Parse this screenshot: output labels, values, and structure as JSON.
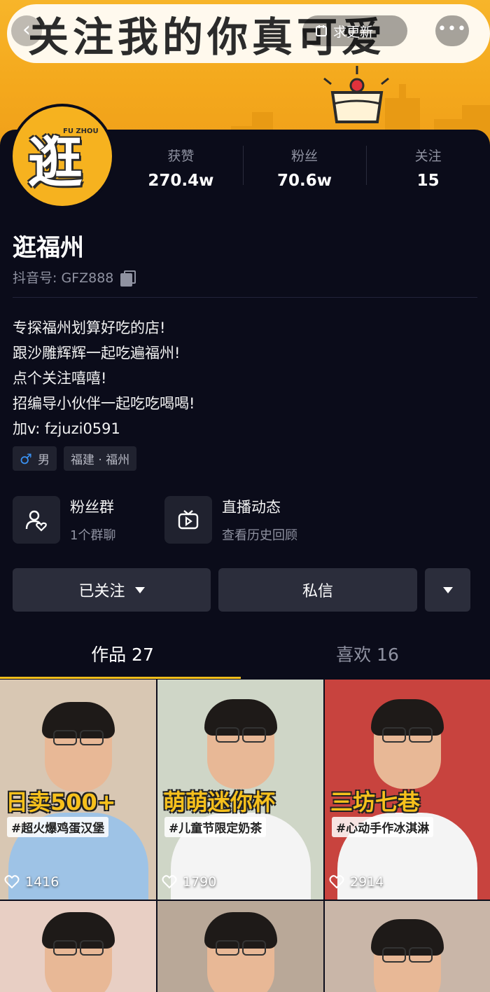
{
  "banner": {
    "title": "关注我的你真可爱",
    "update_label": "求更新",
    "back_glyph": "‹",
    "more_glyph": "•••"
  },
  "avatar": {
    "char": "逛",
    "sub": "FU ZHOU"
  },
  "stats": [
    {
      "label": "获赞",
      "value": "270.4w"
    },
    {
      "label": "粉丝",
      "value": "70.6w"
    },
    {
      "label": "关注",
      "value": "15"
    }
  ],
  "profile": {
    "name": "逛福州",
    "douyin_id": "抖音号: GFZ888",
    "bio": [
      "专探福州划算好吃的店!",
      "跟沙雕辉辉一起吃遍福州!",
      "点个关注嘻嘻!",
      "招编导小伙伴一起吃吃喝喝!",
      "加v: fzjuzi0591"
    ],
    "tags": {
      "gender": "男",
      "location": "福建 · 福州"
    }
  },
  "features": [
    {
      "title": "粉丝群",
      "sub": "1个群聊",
      "icon": "fan-group-icon"
    },
    {
      "title": "直播动态",
      "sub": "查看历史回顾",
      "icon": "tv-icon"
    }
  ],
  "actions": {
    "followed_label": "已关注",
    "message_label": "私信"
  },
  "tabs": [
    {
      "label": "作品 27"
    },
    {
      "label": "喜欢 16"
    }
  ],
  "colors": {
    "accent": "#f6c01c",
    "banner": "#f4a81c",
    "background": "#0b0c1a",
    "button": "#2b2d3b"
  },
  "videos": [
    {
      "tag": "日卖500+",
      "sub": "#超火爆鸡蛋汉堡",
      "likes": "1416",
      "bg": "#d8c7b3",
      "shirt": "#9ec3e6"
    },
    {
      "tag": "萌萌迷你杯",
      "sub": "#儿童节限定奶茶",
      "likes": "1790",
      "bg": "#cfd6c7",
      "shirt": "#f4f4f4"
    },
    {
      "tag": "三坊七巷",
      "sub": "#心动手作冰淇淋",
      "likes": "2914",
      "bg": "#c8433e",
      "shirt": "#f4f4f4"
    }
  ]
}
